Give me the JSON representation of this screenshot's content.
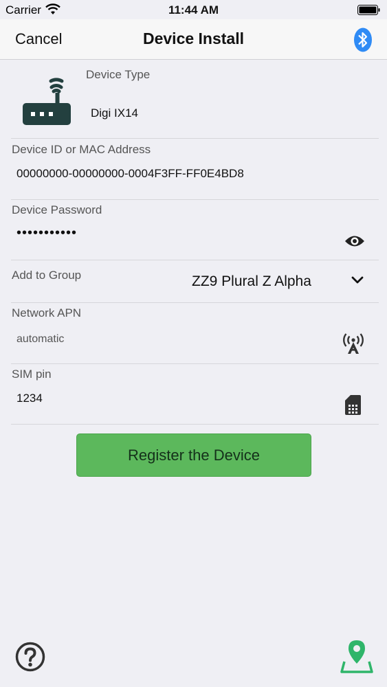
{
  "status_bar": {
    "carrier": "Carrier",
    "time": "11:44 AM"
  },
  "nav": {
    "cancel_label": "Cancel",
    "title": "Device Install",
    "bluetooth_icon": "bluetooth-icon"
  },
  "form": {
    "device_type": {
      "label": "Device Type",
      "value": "Digi IX14",
      "icon": "router-icon"
    },
    "device_id": {
      "label": "Device ID or MAC Address",
      "value": "00000000-00000000-0004F3FF-FF0E4BD8"
    },
    "password": {
      "label": "Device Password",
      "value": "•••••••••••",
      "icon": "eye-icon"
    },
    "group": {
      "label": "Add to Group",
      "value": "ZZ9 Plural Z Alpha",
      "icon": "chevron-down-icon"
    },
    "apn": {
      "label": "Network APN",
      "placeholder": "automatic",
      "icon": "antenna-icon"
    },
    "sim": {
      "label": "SIM pin",
      "value": "1234",
      "icon": "sim-card-icon"
    }
  },
  "register_button": "Register the Device",
  "footer": {
    "help_icon": "help-icon",
    "map_icon": "map-pin-icon"
  },
  "colors": {
    "accent_blue": "#2f8bf5",
    "button_green": "#5cb85c",
    "icon_green": "#2fb56a",
    "router_dark": "#23403f"
  }
}
